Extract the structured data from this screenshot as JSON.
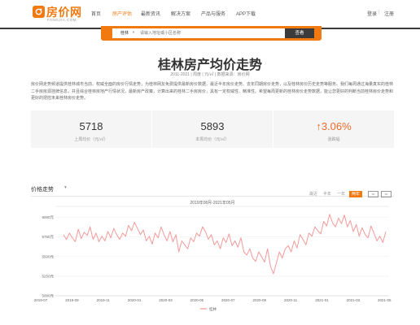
{
  "header": {
    "logo_text": "房价网",
    "logo_sub": "FANGJIA.COM",
    "nav": [
      "首页",
      "房产评估",
      "最新资讯",
      "解决方案",
      "产品与服务",
      "APP下载"
    ],
    "active_nav": 1,
    "login": "登录",
    "separator": "|",
    "register": "注册"
  },
  "search": {
    "city": "桂林",
    "placeholder": "请输入地址或小区名称",
    "button": "查看"
  },
  "page": {
    "title": "桂林房产均价走势",
    "subline": "2011-2021 | 周度 | 元/㎡ | 数据来源：房价网",
    "description": "房价网走势频道提供桂林城市当前、权威全面的房价行情走势，为桂林网友免费提供最新房价数据，最近半年房价走势、去年同期房价走势，以及桂林房价历史走势等服务。我们每周通过海量真实的桂林二手房房源挂牌信息，并且综合桂林房地产行情状况，最新房产政策，计算出来的桂林二手房房价，具有一定权威性、精准性。希望每周更新的桂林房价走势数据，能让您更好的判断当前桂林房价走势和更好的把控未来桂林房价走势。"
  },
  "stats": [
    {
      "value": "5718",
      "label": "上周均价（元/㎡）"
    },
    {
      "value": "5893",
      "label": "本周均价（元/㎡）"
    },
    {
      "value": "↑3.06%",
      "label": "涨跌幅"
    }
  ],
  "trend": {
    "title": "价格走势",
    "ranges": [
      "最近",
      "半年",
      "一年",
      "两年"
    ],
    "active_range": 3
  },
  "colors": {
    "accent": "#f07a10",
    "line": "#f29a9a",
    "up": "#ee6b2b"
  },
  "icons": {
    "logo": "house-logo-icon",
    "dropdown": "chevron-down-icon"
  },
  "chart_data": {
    "type": "line",
    "title": "2019年08月-2021年05月",
    "x_tick_labels": [
      "2019-07",
      "2019-09",
      "2019-11",
      "2020-01",
      "2020-03",
      "2020-05",
      "2020-07",
      "2020-09",
      "2020-11",
      "2021-01",
      "2021-03",
      "2021-05"
    ],
    "y_tick_labels": [
      "5000元",
      "5250元",
      "5500元",
      "5750元",
      "6000元"
    ],
    "ylim": [
      5000,
      6100
    ],
    "grid": true,
    "legend": "bottom-center",
    "series": [
      {
        "name": "桂林",
        "values": [
          5780,
          5720,
          5800,
          5740,
          5690,
          5850,
          5730,
          5810,
          5770,
          5880,
          5720,
          5800,
          5690,
          5760,
          5700,
          5820,
          5740,
          5860,
          5780,
          5720,
          5800,
          5760,
          5900,
          5830,
          5940,
          5860,
          5780,
          5840,
          5700,
          5760,
          5660,
          5800,
          5740,
          5880,
          5780,
          5700,
          5820,
          5690,
          5780,
          5560,
          5700,
          5650,
          5600,
          5740,
          5690,
          5800,
          5760,
          5880,
          5820,
          5720,
          5780,
          5650,
          5700,
          5600,
          5740,
          5680,
          5790,
          5640,
          5700,
          5620,
          5740,
          5560,
          5520,
          5600,
          5480,
          5440,
          5560,
          5500,
          5430,
          5600,
          5380,
          5280,
          5420,
          5560,
          5480,
          5600,
          5640,
          5560,
          5700,
          5610,
          5780,
          5720,
          5650,
          5800,
          5760,
          5880,
          5830,
          5790,
          5950,
          5890,
          6040,
          5930,
          5880,
          5990,
          5920,
          6030,
          5880,
          5960,
          5820,
          5910,
          5760,
          5870,
          5780,
          5740,
          5890,
          5800,
          5700,
          5760,
          5680,
          5820
        ]
      }
    ]
  }
}
